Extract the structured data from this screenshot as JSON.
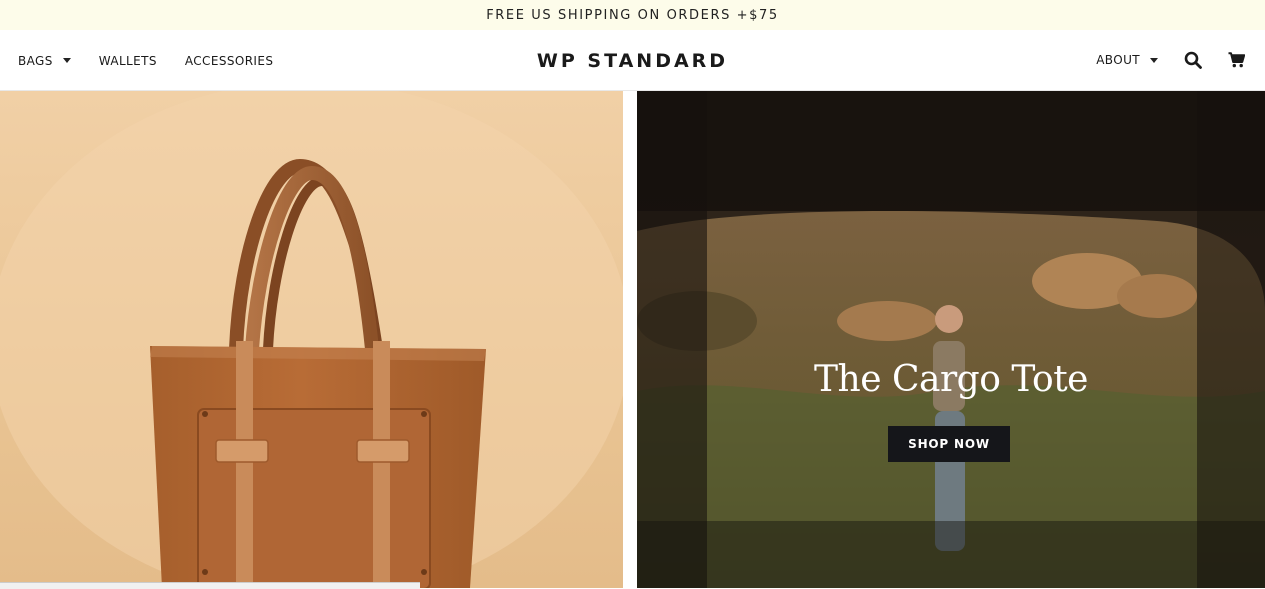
{
  "announcement": {
    "text": "FREE US SHIPPING ON ORDERS +$75"
  },
  "nav": {
    "left": [
      {
        "label": "BAGS",
        "has_dropdown": true
      },
      {
        "label": "WALLETS",
        "has_dropdown": false
      },
      {
        "label": "ACCESSORIES",
        "has_dropdown": false
      }
    ],
    "logo": "WP STANDARD",
    "about": "ABOUT",
    "icons": {
      "search": "search-icon",
      "cart": "cart-icon"
    }
  },
  "hero": {
    "left_image": "leather-tote-bag-product-photo",
    "right_image": "woman-in-desert-with-tote-photo",
    "title": "The Cargo Tote",
    "cta": "SHOP NOW"
  },
  "colors": {
    "announcement_bg": "#fdfcea",
    "cta_bg": "#15161a",
    "left_panel_bg": "#f1d0a6"
  }
}
